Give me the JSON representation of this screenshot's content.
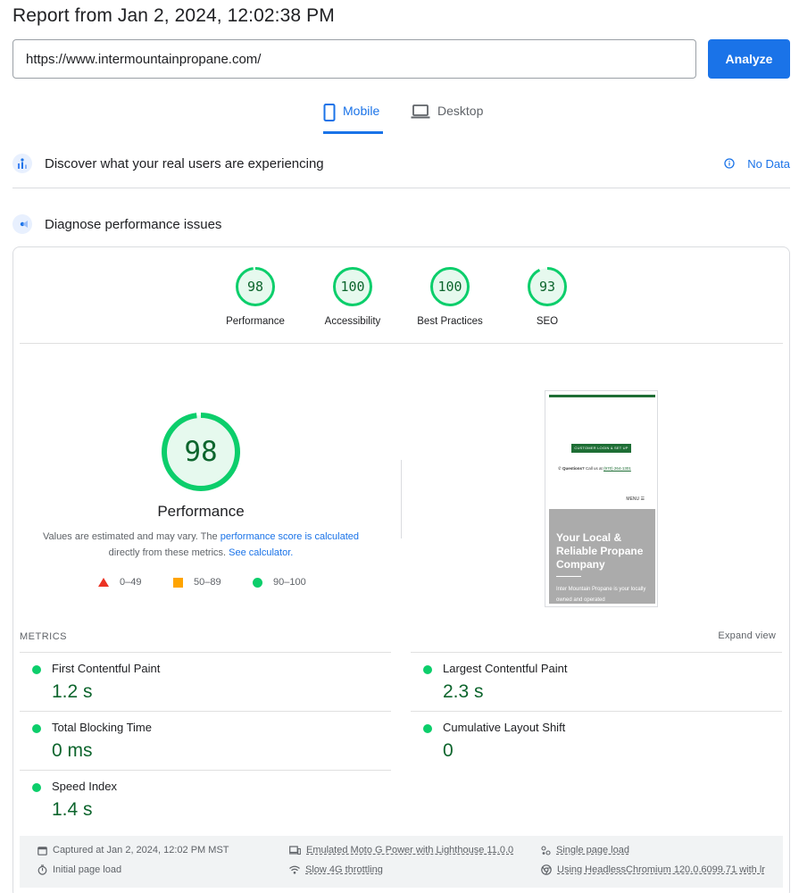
{
  "report": {
    "title": "Report from Jan 2, 2024, 12:02:38 PM",
    "url": "https://www.intermountainpropane.com/",
    "analyze_label": "Analyze"
  },
  "device_tabs": {
    "mobile": "Mobile",
    "desktop": "Desktop"
  },
  "crux": {
    "title": "Discover what your real users are experiencing",
    "no_data": "No Data"
  },
  "diagnose": {
    "title": "Diagnose performance issues"
  },
  "scores": [
    {
      "label": "Performance",
      "value": "98",
      "score": 98
    },
    {
      "label": "Accessibility",
      "value": "100",
      "score": 100
    },
    {
      "label": "Best Practices",
      "value": "100",
      "score": 100
    },
    {
      "label": "SEO",
      "value": "93",
      "score": 93
    }
  ],
  "performance": {
    "score": "98",
    "title": "Performance",
    "desc_pre": "Values are estimated and may vary. The ",
    "desc_link1": "performance score is calculated",
    "desc_mid": "directly from these metrics. ",
    "desc_link2": "See calculator."
  },
  "legend": {
    "poor": "0–49",
    "average": "50–89",
    "good": "90–100"
  },
  "screenshot": {
    "login_button": "CUSTOMER LOGIN & SET UP",
    "questions_bold": "Questions?",
    "questions_text": " Call us at ",
    "phone": "(970) 264-1301",
    "menu": "MENU ☰",
    "hero_title": "Your Local & Reliable Propane Company",
    "hero_text": "Inter Mountain Propane is your locally owned and operated"
  },
  "metrics": {
    "heading": "METRICS",
    "expand": "Expand view",
    "fcp": {
      "name": "First Contentful Paint",
      "value": "1.2 s"
    },
    "lcp": {
      "name": "Largest Contentful Paint",
      "value": "2.3 s"
    },
    "tbt": {
      "name": "Total Blocking Time",
      "value": "0 ms"
    },
    "cls": {
      "name": "Cumulative Layout Shift",
      "value": "0"
    },
    "si": {
      "name": "Speed Index",
      "value": "1.4 s"
    }
  },
  "footer": {
    "captured": "Captured at Jan 2, 2024, 12:02 PM MST",
    "initial_load": "Initial page load",
    "emulated": "Emulated Moto G Power with Lighthouse 11.0.0",
    "throttling": "Slow 4G throttling",
    "single_load": "Single page load",
    "browser": "Using HeadlessChromium 120.0.6099.71 with lr"
  },
  "colors": {
    "pass": "#0cce6b",
    "pass_text": "#0d652d",
    "pass_bg": "#e6f9ee",
    "average": "#ffa400",
    "fail": "#eb3223",
    "accent": "#1a73e8"
  }
}
